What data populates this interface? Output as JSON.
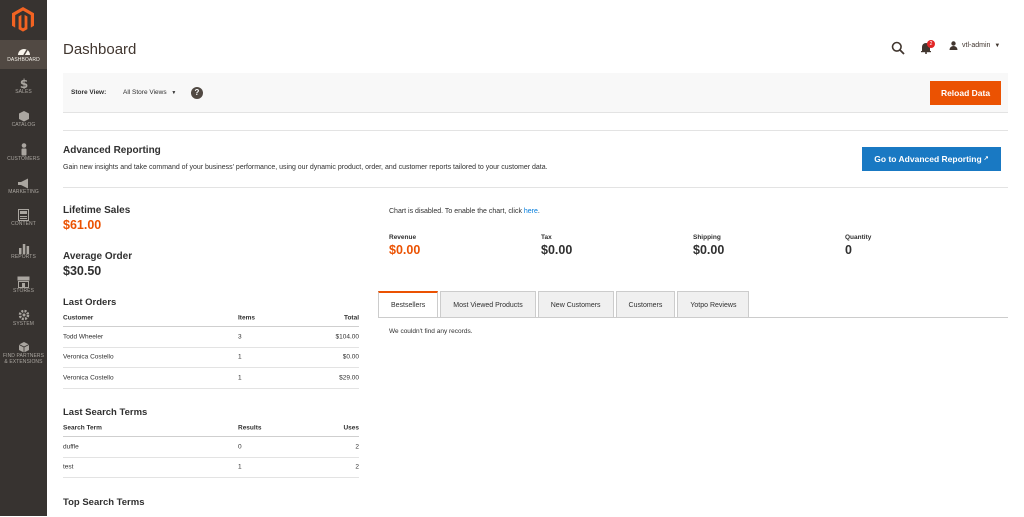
{
  "colors": {
    "sidebar": "#373330",
    "accent": "#eb5202",
    "link": "#007bdb",
    "primary": "#1979c3"
  },
  "nav": [
    {
      "label": "DASHBOARD",
      "icon": "dashboard-icon",
      "active": true
    },
    {
      "label": "SALES",
      "icon": "dollar-icon"
    },
    {
      "label": "CATALOG",
      "icon": "cube-icon"
    },
    {
      "label": "CUSTOMERS",
      "icon": "person-icon"
    },
    {
      "label": "MARKETING",
      "icon": "megaphone-icon"
    },
    {
      "label": "CONTENT",
      "icon": "content-icon"
    },
    {
      "label": "REPORTS",
      "icon": "bar-chart-icon"
    },
    {
      "label": "STORES",
      "icon": "store-icon"
    },
    {
      "label": "SYSTEM",
      "icon": "gear-icon"
    },
    {
      "label": "FIND PARTNERS",
      "label2": "& EXTENSIONS",
      "icon": "cubes-icon"
    }
  ],
  "header": {
    "title": "Dashboard",
    "notifications": "2",
    "user": "vtl-admin"
  },
  "storebar": {
    "label": "Store View:",
    "selected": "All Store Views",
    "reload": "Reload Data"
  },
  "advanced": {
    "title": "Advanced Reporting",
    "desc": "Gain new insights and take command of your business' performance, using our dynamic product, order, and customer reports tailored to your customer data.",
    "button": "Go to Advanced Reporting"
  },
  "stats": {
    "lifetime_label": "Lifetime Sales",
    "lifetime_value": "$61.00",
    "avg_label": "Average Order",
    "avg_value": "$30.50"
  },
  "last_orders": {
    "title": "Last Orders",
    "headers": [
      "Customer",
      "Items",
      "Total"
    ],
    "rows": [
      [
        "Todd Wheeler",
        "3",
        "$104.00"
      ],
      [
        "Veronica Costello",
        "1",
        "$0.00"
      ],
      [
        "Veronica Costello",
        "1",
        "$29.00"
      ]
    ]
  },
  "last_search": {
    "title": "Last Search Terms",
    "headers": [
      "Search Term",
      "Results",
      "Uses"
    ],
    "rows": [
      [
        "duffle",
        "0",
        "2"
      ],
      [
        "test",
        "1",
        "2"
      ]
    ]
  },
  "top_search": {
    "title": "Top Search Terms"
  },
  "chart": {
    "msg": "Chart is disabled. To enable the chart, click ",
    "link": "here",
    "msg_end": "."
  },
  "totals": [
    {
      "label": "Revenue",
      "value": "$0.00"
    },
    {
      "label": "Tax",
      "value": "$0.00"
    },
    {
      "label": "Shipping",
      "value": "$0.00"
    },
    {
      "label": "Quantity",
      "value": "0"
    }
  ],
  "tabs": [
    "Bestsellers",
    "Most Viewed Products",
    "New Customers",
    "Customers",
    "Yotpo Reviews"
  ],
  "empty": "We couldn't find any records."
}
